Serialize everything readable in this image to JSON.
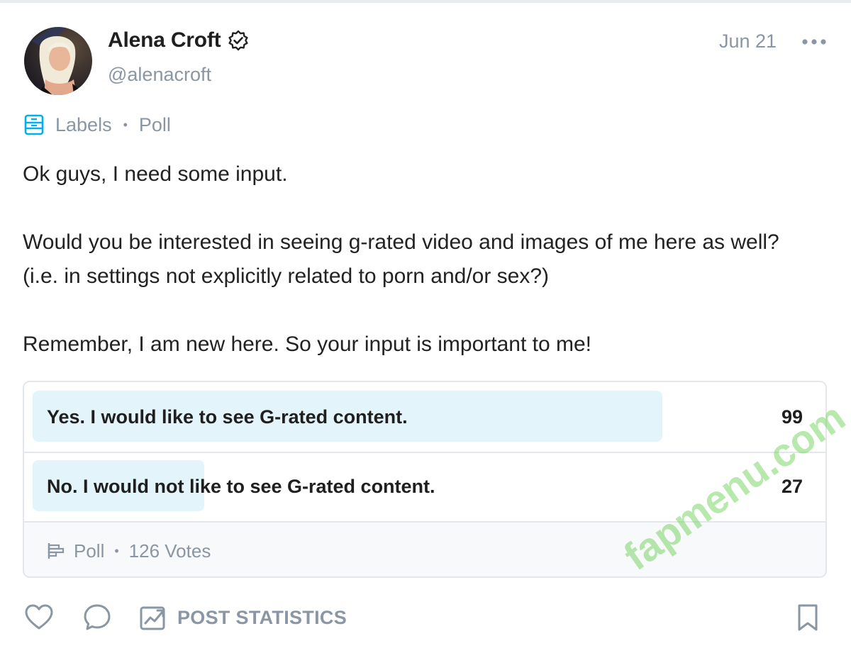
{
  "post": {
    "author": {
      "name": "Alena Croft",
      "handle": "@alenacroft",
      "verified": true
    },
    "date": "Jun 21",
    "labels": {
      "label_text": "Labels",
      "tag": "Poll"
    },
    "text": {
      "line1": "Ok guys, I need some input.",
      "line2": "Would you be interested in seeing g-rated video and images of me here as well?",
      "line3": "(i.e. in settings not explicitly related to porn and/or sex?)",
      "line4": "Remember, I am new here. So your input is important to me!"
    },
    "poll": {
      "options": [
        {
          "label": "Yes. I would like to see G-rated content.",
          "votes": "99",
          "share": 0.79
        },
        {
          "label": "No. I would not like to see G-rated content.",
          "votes": "27",
          "share": 0.21
        }
      ],
      "footer_type": "Poll",
      "footer_votes": "126 Votes"
    },
    "actions": {
      "statistics_label": "POST STATISTICS"
    }
  },
  "watermark": "fapmenu.com",
  "colors": {
    "accent": "#00aff0",
    "muted_text": "#8a96a3",
    "poll_fill": "#e3f4fb",
    "poll_footer_bg": "#f7f9fa",
    "watermark": "#7cd668"
  },
  "icons": {
    "verified": "verified-badge-icon",
    "more": "more-dots-icon",
    "labels": "labels-icon",
    "poll": "poll-icon",
    "like": "heart-icon",
    "comment": "comment-icon",
    "statistics": "statistics-icon",
    "bookmark": "bookmark-icon"
  }
}
